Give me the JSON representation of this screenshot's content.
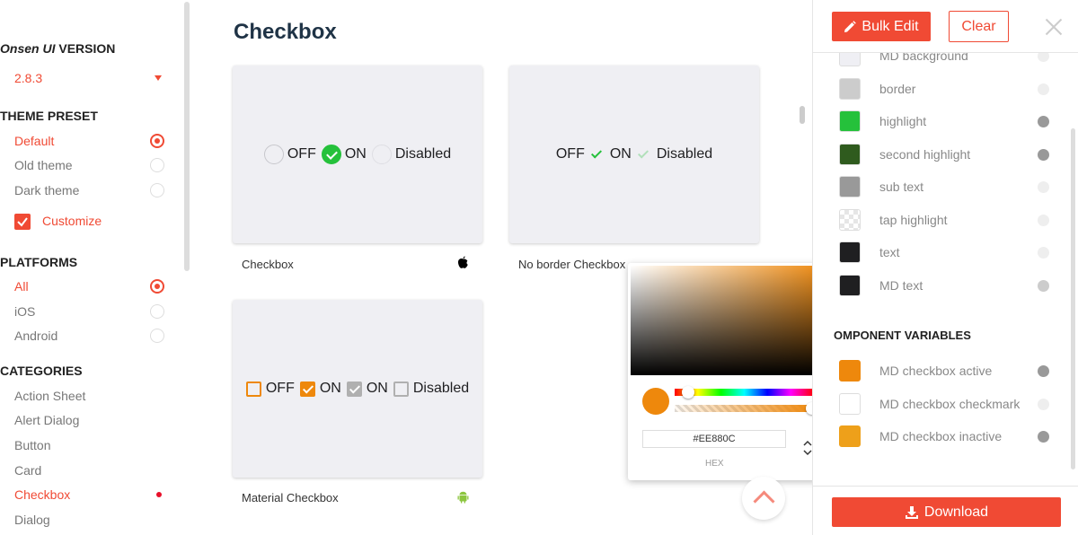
{
  "sidebar": {
    "version_heading_italic": "Onsen UI",
    "version_heading_rest": " VERSION",
    "version_value": "2.8.3",
    "theme_heading": "THEME PRESET",
    "themes": [
      {
        "label": "Default",
        "selected": true
      },
      {
        "label": "Old theme",
        "selected": false
      },
      {
        "label": "Dark theme",
        "selected": false
      }
    ],
    "customize_label": "Customize",
    "customize_checked": true,
    "platforms_heading": "PLATFORMS",
    "platforms": [
      {
        "label": "All",
        "selected": true
      },
      {
        "label": "iOS",
        "selected": false
      },
      {
        "label": "Android",
        "selected": false
      }
    ],
    "categories_heading": "CATEGORIES",
    "categories": [
      {
        "label": "Action Sheet"
      },
      {
        "label": "Alert Dialog"
      },
      {
        "label": "Button"
      },
      {
        "label": "Card"
      },
      {
        "label": "Checkbox",
        "active": true
      },
      {
        "label": "Dialog"
      }
    ]
  },
  "main": {
    "title": "Checkbox",
    "cards": [
      {
        "label": "Checkbox",
        "platform_icon": "apple-icon",
        "demo": {
          "off": "OFF",
          "on": "ON",
          "disabled": "Disabled"
        }
      },
      {
        "label": "No border Checkbox",
        "platform_icon": "apple-icon",
        "demo": {
          "off": "OFF",
          "on": "ON",
          "disabled": "Disabled"
        }
      },
      {
        "label": "Material Checkbox",
        "platform_icon": "android-icon",
        "demo": {
          "off": "OFF",
          "on": "ON",
          "on2": "ON",
          "disabled": "Disabled"
        }
      }
    ]
  },
  "color_picker": {
    "hex_value": "#EE880C",
    "mode_label": "HEX",
    "color": "#EE880C"
  },
  "right_panel": {
    "bulk_edit_label": "Bulk Edit",
    "clear_label": "Clear",
    "download_label": "Download",
    "component_heading": "OMPONENT VARIABLES",
    "theme_vars": [
      {
        "label": "MD background",
        "color": "#efeff4",
        "modified": false
      },
      {
        "label": "border",
        "color": "#cccccc",
        "modified": false
      },
      {
        "label": "highlight",
        "color": "#25c13b",
        "modified": true
      },
      {
        "label": "second highlight",
        "color": "#2f5b1e",
        "modified": true
      },
      {
        "label": "sub text",
        "color": "#999999",
        "modified": false
      },
      {
        "label": "tap highlight",
        "color": "checker",
        "modified": false
      },
      {
        "label": "text",
        "color": "#1f1f21",
        "modified": false
      },
      {
        "label": "MD text",
        "color": "#1f1f21",
        "modified": "partial"
      }
    ],
    "component_vars": [
      {
        "label": "MD checkbox active",
        "color": "#ee880c",
        "modified": true
      },
      {
        "label": "MD checkbox checkmark",
        "color": "#ffffff",
        "modified": false
      },
      {
        "label": "MD checkbox inactive",
        "color": "#eea01a",
        "modified": true
      }
    ]
  },
  "colors": {
    "accent": "#f04a34",
    "ios_highlight": "#25c13b",
    "md_checkbox": "#ee880c"
  }
}
